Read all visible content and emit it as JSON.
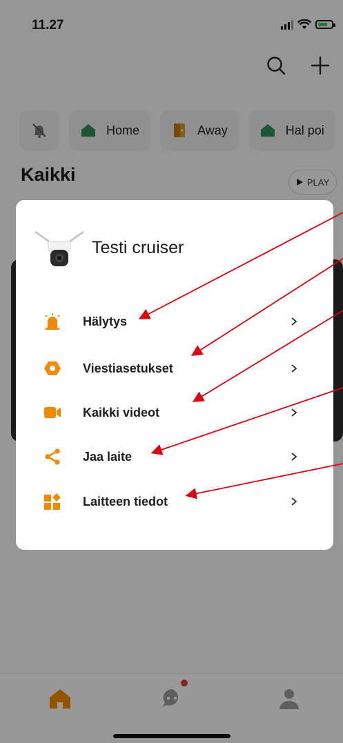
{
  "status_bar": {
    "time": "11.27"
  },
  "scenes": {
    "items": [
      {
        "label": "Home",
        "icon": "house-icon"
      },
      {
        "label": "Away",
        "icon": "door-icon"
      },
      {
        "label": "Hal poi",
        "icon": "house-icon"
      }
    ]
  },
  "section": {
    "title": "Kaikki",
    "play_label": "PLAY"
  },
  "modal": {
    "device_name": "Testi cruiser",
    "items": [
      {
        "label": "Hälytys",
        "icon": "alarm-siren-icon"
      },
      {
        "label": "Viestiasetukset",
        "icon": "message-settings-icon"
      },
      {
        "label": "Kaikki videot",
        "icon": "video-camera-icon"
      },
      {
        "label": "Jaa laite",
        "icon": "share-icon"
      },
      {
        "label": "Laitteen tiedot",
        "icon": "device-info-icon"
      }
    ]
  },
  "colors": {
    "accent": "#f08a00",
    "annotation_arrow": "#e0000f",
    "scene_green": "#2e8b57"
  }
}
